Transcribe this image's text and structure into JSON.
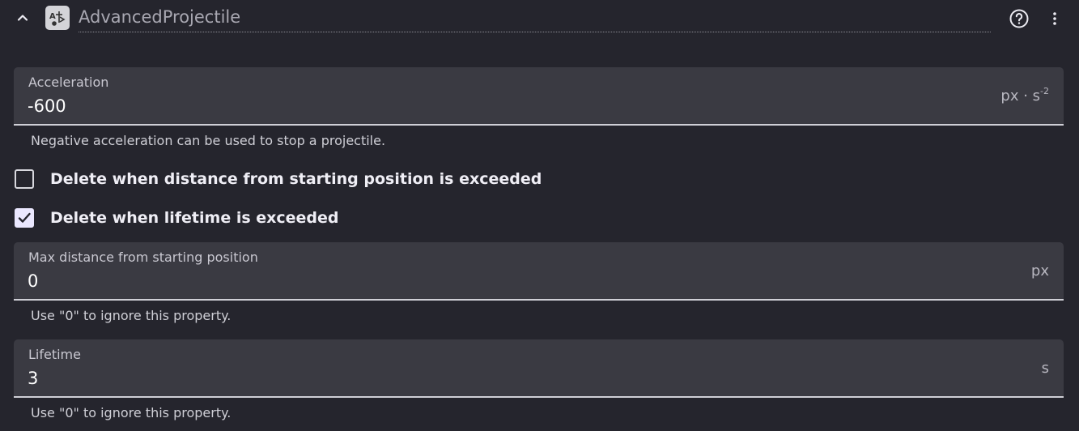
{
  "header": {
    "title": "AdvancedProjectile",
    "behavior_icon": "projectile-behavior-icon",
    "collapse_icon": "chevron-up-icon",
    "help_icon": "help-circle-icon",
    "more_icon": "more-vertical-icon"
  },
  "acceleration": {
    "label": "Acceleration",
    "value": "-600",
    "unit_base": "px · s",
    "unit_sup": "-2",
    "helper": "Negative acceleration can be used to stop a projectile."
  },
  "delete_distance": {
    "label": "Delete when distance from starting position is exceeded",
    "checked": false
  },
  "delete_lifetime": {
    "label": "Delete when lifetime is exceeded",
    "checked": true
  },
  "max_distance": {
    "label": "Max distance from starting position",
    "value": "0",
    "unit": "px",
    "helper": "Use \"0\" to ignore this property."
  },
  "lifetime": {
    "label": "Lifetime",
    "value": "3",
    "unit": "s",
    "helper": "Use \"0\" to ignore this property."
  },
  "colors": {
    "background": "#25252d",
    "field_background": "#3a3a42",
    "checkbox_checked": "#ebe8ff"
  }
}
